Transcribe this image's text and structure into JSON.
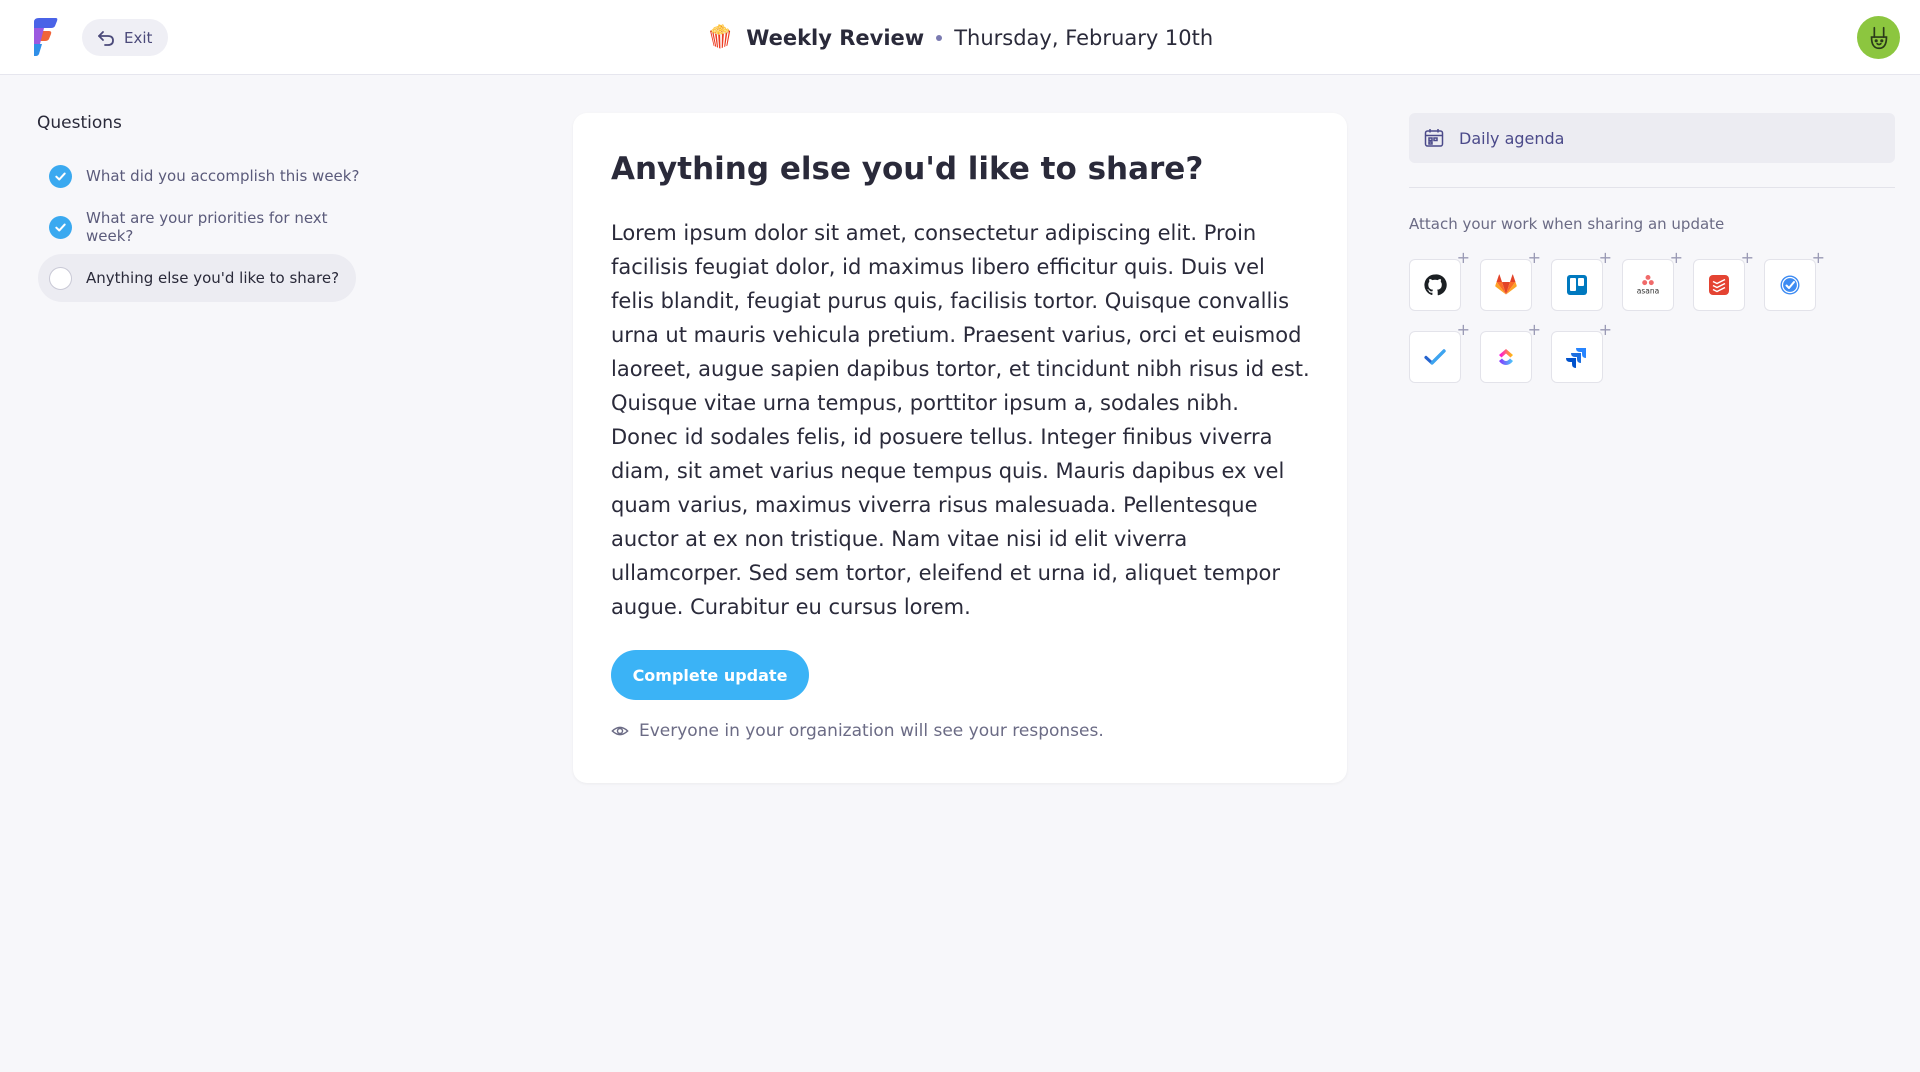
{
  "header": {
    "exit_label": "Exit",
    "emoji": "🍿",
    "title": "Weekly Review",
    "date": "Thursday, February 10th"
  },
  "sidebar": {
    "title": "Questions",
    "items": [
      {
        "label": "What did you accomplish this week?",
        "state": "done"
      },
      {
        "label": "What are your priorities for next week?",
        "state": "done"
      },
      {
        "label": "Anything else you'd like to share?",
        "state": "current"
      }
    ]
  },
  "main": {
    "title": "Anything else you'd like to share?",
    "body": "Lorem ipsum dolor sit amet, consectetur adipiscing elit. Proin facilisis feugiat dolor, id maximus libero efficitur quis. Duis vel felis blandit, feugiat purus quis, facilisis tortor. Quisque convallis urna ut mauris vehicula pretium. Praesent varius, orci et euismod laoreet, augue sapien dapibus tortor, et tincidunt nibh risus id est. Quisque vitae urna tempus, porttitor ipsum a, sodales nibh. Donec id sodales felis, id posuere tellus. Integer finibus viverra diam, sit amet varius neque tempus quis. Mauris dapibus ex vel quam varius, maximus viverra risus malesuada. Pellentesque auctor at ex non tristique. Nam vitae nisi id elit viverra ullamcorper. Sed sem tortor, eleifend et urna id, aliquet tempor augue. Curabitur eu cursus lorem.",
    "complete_label": "Complete update",
    "visibility_note": "Everyone in your organization will see your responses."
  },
  "right": {
    "agenda_label": "Daily agenda",
    "attach_label": "Attach your work when sharing an update",
    "integrations": [
      {
        "name": "github-icon"
      },
      {
        "name": "gitlab-icon"
      },
      {
        "name": "trello-icon"
      },
      {
        "name": "asana-icon",
        "text": "asana"
      },
      {
        "name": "todoist-icon"
      },
      {
        "name": "things-icon"
      },
      {
        "name": "microsoft-todo-icon"
      },
      {
        "name": "clickup-icon"
      },
      {
        "name": "jira-icon"
      }
    ]
  },
  "colors": {
    "accent": "#3bb3f6",
    "check": "#3aa9f0",
    "avatar_bg": "#8cc63f",
    "nav_text": "#4b4a8a"
  }
}
